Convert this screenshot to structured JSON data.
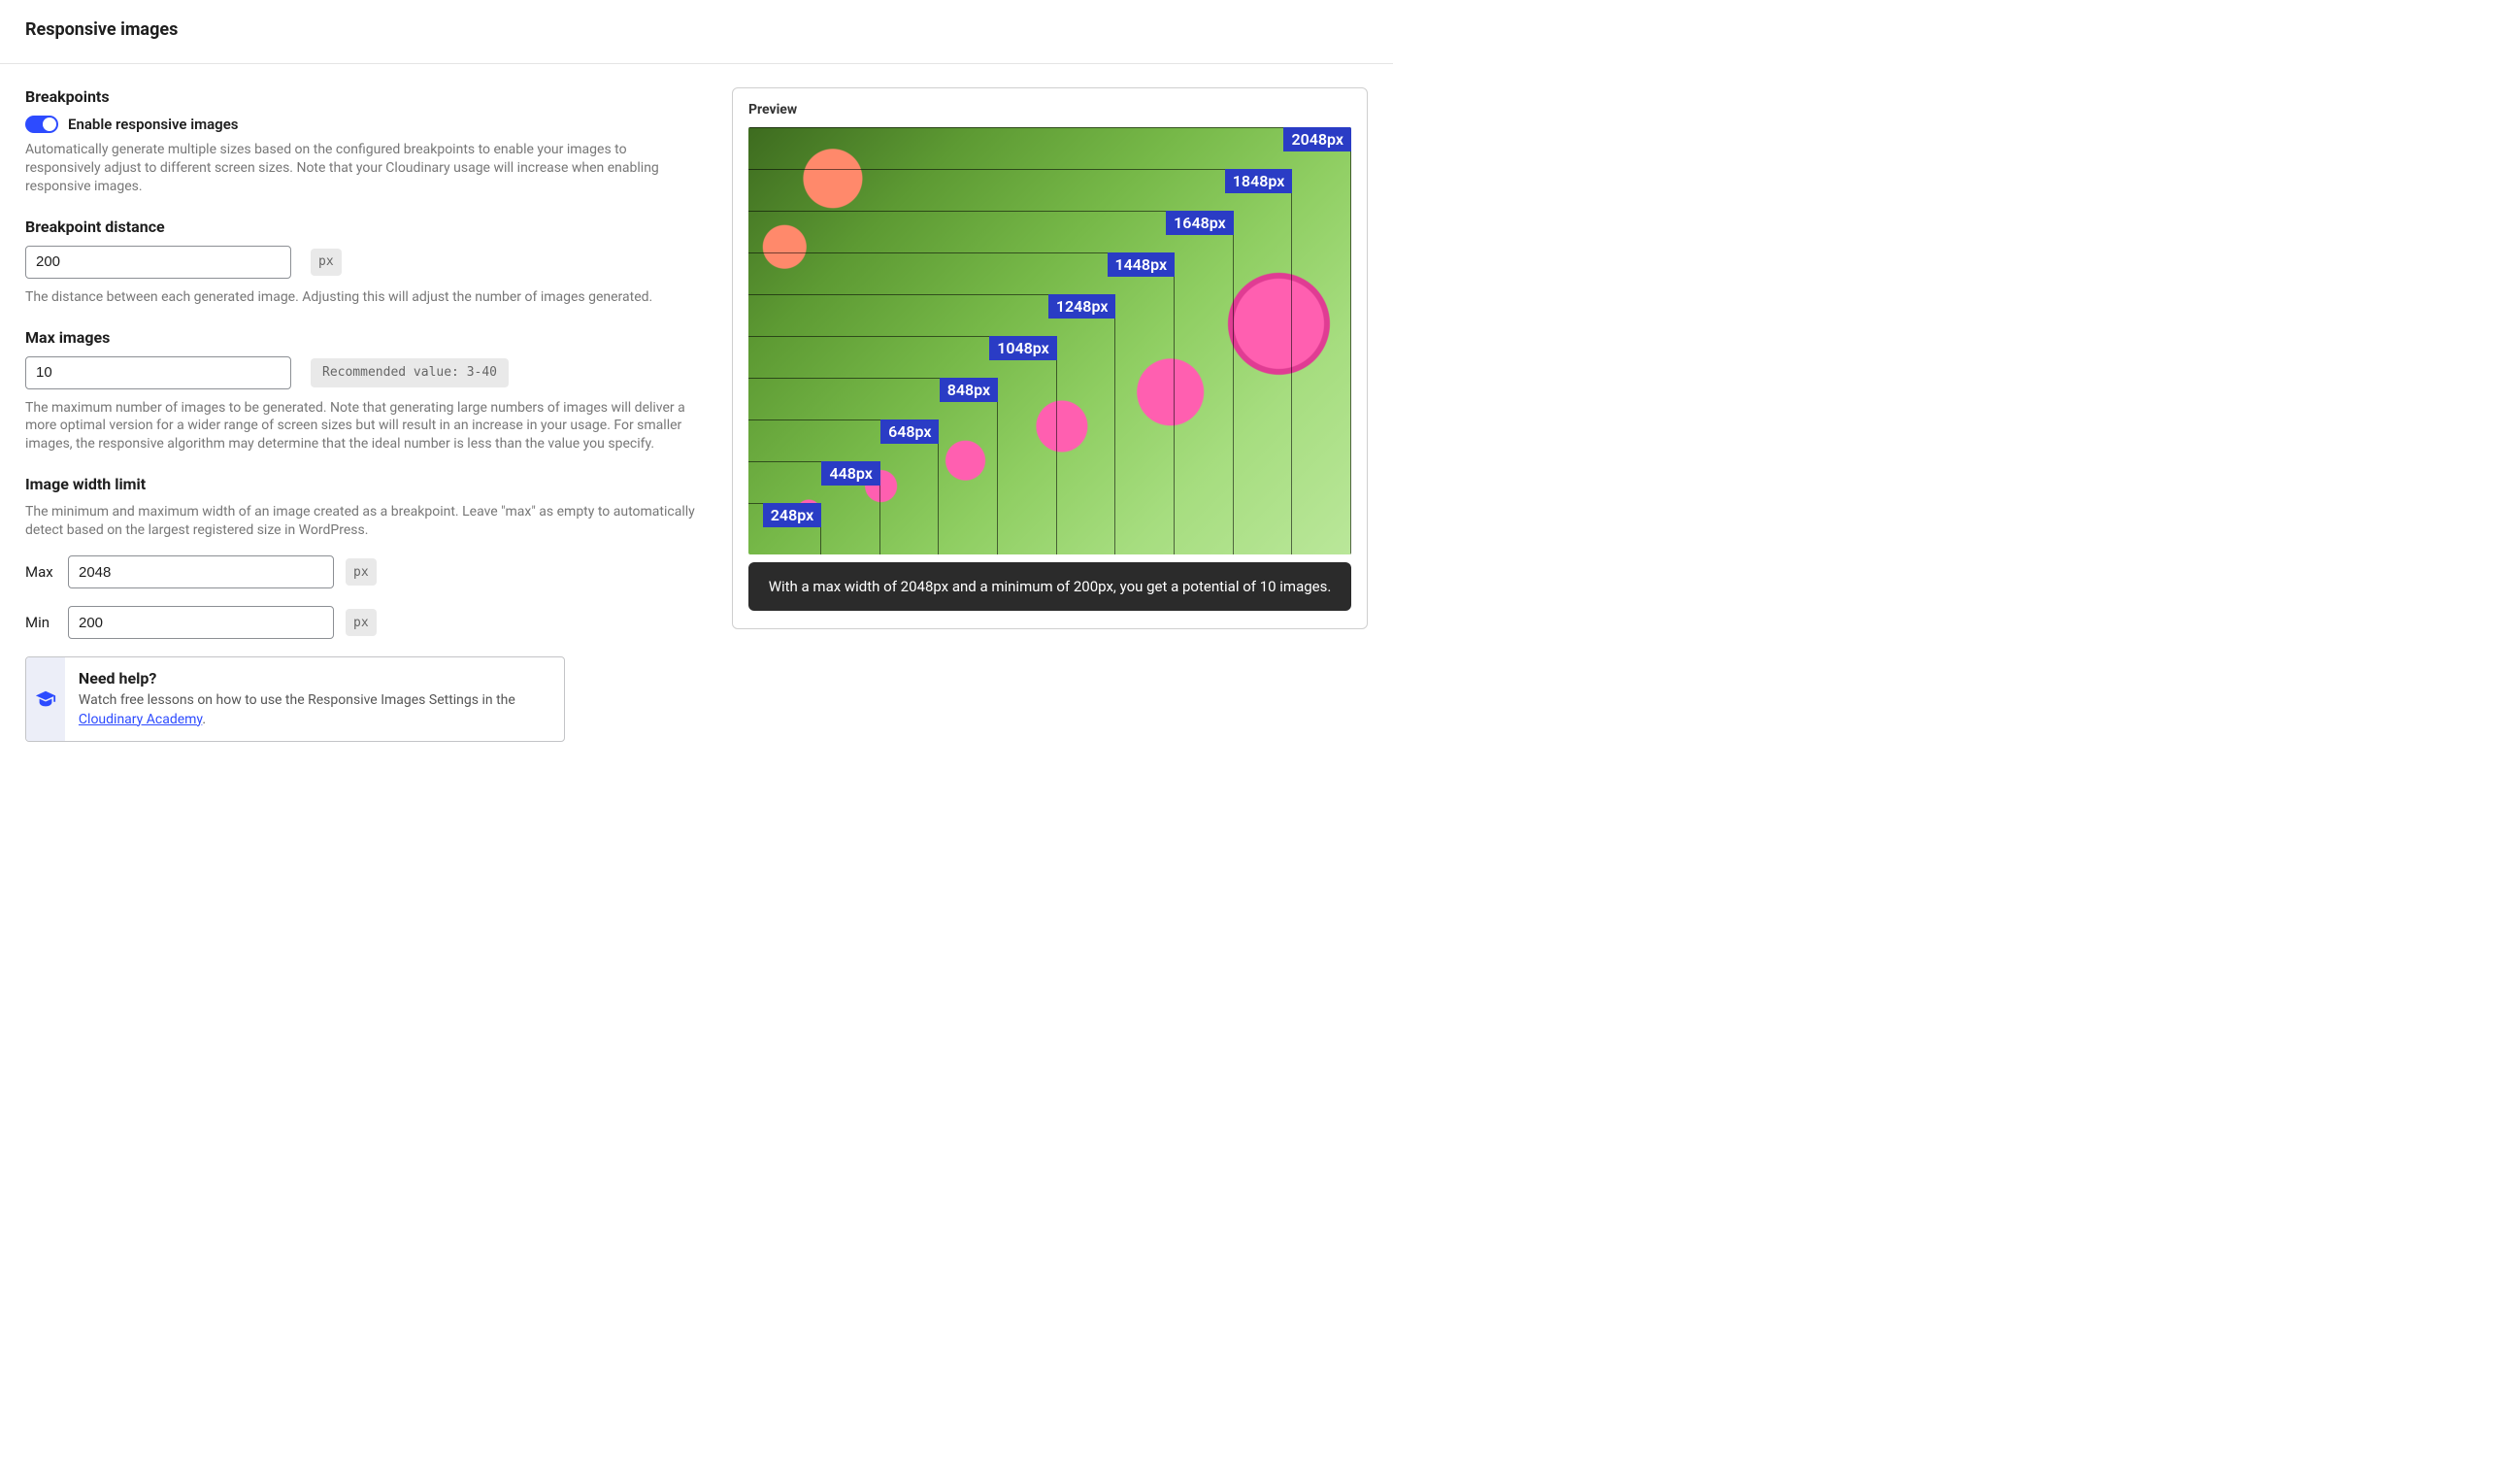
{
  "page": {
    "title": "Responsive images"
  },
  "breakpoints": {
    "title": "Breakpoints",
    "toggle_label": "Enable responsive images",
    "toggle_on": true,
    "help": "Automatically generate multiple sizes based on the configured breakpoints to enable your images to responsively adjust to different screen sizes. Note that your Cloudinary usage will increase when enabling responsive images."
  },
  "distance": {
    "label": "Breakpoint distance",
    "value": "200",
    "unit": "px",
    "help": "The distance between each generated image. Adjusting this will adjust the number of images generated."
  },
  "max_images": {
    "label": "Max images",
    "value": "10",
    "recommended": "Recommended value: 3-40",
    "help": "The maximum number of images to be generated. Note that generating large numbers of images will deliver a more optimal version for a wider range of screen sizes but will result in an increase in your usage. For smaller images, the responsive algorithm may determine that the ideal number is less than the value you specify."
  },
  "width_limit": {
    "label": "Image width limit",
    "help": "The minimum and maximum width of an image created as a breakpoint. Leave \"max\" as empty to automatically detect based on the largest registered size in WordPress.",
    "max_label": "Max",
    "max_value": "2048",
    "max_unit": "px",
    "min_label": "Min",
    "min_value": "200",
    "min_unit": "px"
  },
  "help_card": {
    "title": "Need help?",
    "body_prefix": "Watch free lessons on how to use the Responsive Images Settings in the ",
    "link_text": "Cloudinary Academy",
    "body_suffix": "."
  },
  "preview": {
    "title": "Preview",
    "frames": [
      {
        "label": "2048px",
        "w_pct": 100.0,
        "h_pct": 100.0
      },
      {
        "label": "1848px",
        "w_pct": 90.23,
        "h_pct": 90.23
      },
      {
        "label": "1648px",
        "w_pct": 80.47,
        "h_pct": 80.47
      },
      {
        "label": "1448px",
        "w_pct": 70.7,
        "h_pct": 70.7
      },
      {
        "label": "1248px",
        "w_pct": 60.94,
        "h_pct": 60.94
      },
      {
        "label": "1048px",
        "w_pct": 51.17,
        "h_pct": 51.17
      },
      {
        "label": "848px",
        "w_pct": 41.41,
        "h_pct": 41.41
      },
      {
        "label": "648px",
        "w_pct": 31.64,
        "h_pct": 31.64
      },
      {
        "label": "448px",
        "w_pct": 21.88,
        "h_pct": 21.88
      },
      {
        "label": "248px",
        "w_pct": 12.11,
        "h_pct": 12.11
      }
    ],
    "caption": "With a max width of 2048px and a minimum of 200px, you get a potential of 10 images."
  }
}
